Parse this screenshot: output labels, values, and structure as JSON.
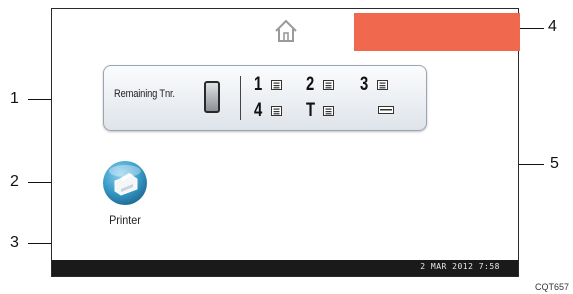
{
  "toner_panel": {
    "label": "Remaining Tnr.",
    "slots": [
      {
        "label": "1",
        "icon": "paper-tray-icon"
      },
      {
        "label": "2",
        "icon": "paper-tray-icon"
      },
      {
        "label": "3",
        "icon": "paper-tray-icon"
      },
      {
        "label": "4",
        "icon": "paper-tray-icon"
      },
      {
        "label": "T",
        "icon": "paper-tray-icon"
      },
      {
        "label": "",
        "icon": "bypass-tray-icon"
      }
    ]
  },
  "printer": {
    "label": "Printer",
    "icon": "printer-icon"
  },
  "home": {
    "icon": "home-icon"
  },
  "alert": {
    "color": "#f0694e"
  },
  "status_bar": {
    "datetime": "2 MAR  2012  7:58"
  },
  "callouts": [
    "1",
    "2",
    "3",
    "4",
    "5"
  ],
  "figure_code": "CQT657",
  "colors": {
    "accent": "#f0694e",
    "status_bar": "#1a1a1a",
    "printer_icon": "#3a9cc9"
  }
}
